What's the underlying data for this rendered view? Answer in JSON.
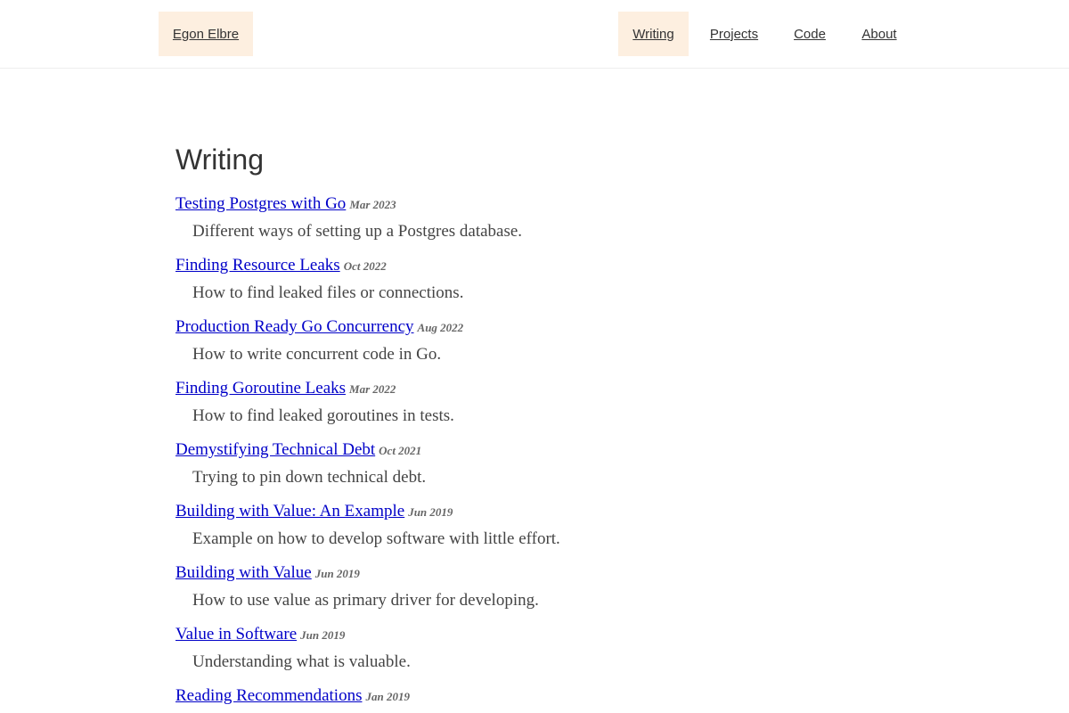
{
  "header": {
    "brand": "Egon Elbre",
    "nav": [
      {
        "label": "Writing",
        "active": true
      },
      {
        "label": "Projects",
        "active": false
      },
      {
        "label": "Code",
        "active": false
      },
      {
        "label": "About",
        "active": false
      }
    ]
  },
  "main": {
    "title": "Writing",
    "posts": [
      {
        "title": "Testing Postgres with Go",
        "date": "Mar 2023",
        "description": "Different ways of setting up a Postgres database."
      },
      {
        "title": "Finding Resource Leaks",
        "date": "Oct 2022",
        "description": "How to find leaked files or connections."
      },
      {
        "title": "Production Ready Go Concurrency",
        "date": "Aug 2022",
        "description": "How to write concurrent code in Go."
      },
      {
        "title": "Finding Goroutine Leaks",
        "date": "Mar 2022",
        "description": "How to find leaked goroutines in tests."
      },
      {
        "title": "Demystifying Technical Debt",
        "date": "Oct 2021",
        "description": "Trying to pin down technical debt."
      },
      {
        "title": "Building with Value: An Example",
        "date": "Jun 2019",
        "description": "Example on how to develop software with little effort."
      },
      {
        "title": "Building with Value",
        "date": "Jun 2019",
        "description": "How to use value as primary driver for developing."
      },
      {
        "title": "Value in Software",
        "date": "Jun 2019",
        "description": "Understanding what is valuable."
      },
      {
        "title": "Reading Recommendations",
        "date": "Jan 2019",
        "description": ""
      }
    ]
  }
}
